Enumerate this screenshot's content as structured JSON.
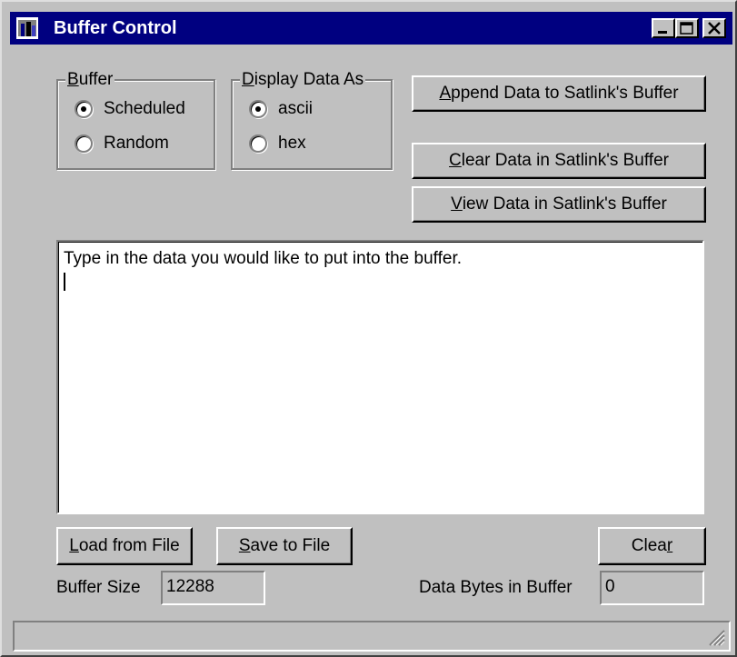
{
  "window": {
    "title": "Buffer Control",
    "icon": "app-icon"
  },
  "titlebar_buttons": {
    "minimize": "minimize-icon",
    "maximize": "maximize-icon",
    "close": "close-icon"
  },
  "buffer_group": {
    "legend_prefix": "",
    "legend_ul": "B",
    "legend_rest": "uffer",
    "options": [
      {
        "label": "Scheduled",
        "checked": true
      },
      {
        "label": "Random",
        "checked": false
      }
    ]
  },
  "display_group": {
    "legend_prefix": "",
    "legend_ul": "D",
    "legend_rest": "isplay Data As",
    "options": [
      {
        "label": "ascii",
        "checked": true
      },
      {
        "label": "hex",
        "checked": false
      }
    ]
  },
  "buttons": {
    "append": {
      "ul": "A",
      "rest": "ppend Data to Satlink's Buffer"
    },
    "clear_data": {
      "ul": "C",
      "rest": "lear Data in Satlink's Buffer"
    },
    "view_data": {
      "ul": "V",
      "rest": "iew Data in Satlink's Buffer"
    },
    "load": {
      "ul": "L",
      "rest": "oad from File"
    },
    "save": {
      "ul": "S",
      "rest": "ave to File"
    },
    "clear": {
      "pre": "Clea",
      "ul": "r"
    }
  },
  "editor": {
    "text": "Type in the data you would like to put into the buffer."
  },
  "buffer_size": {
    "label": "Buffer Size",
    "value": "12288"
  },
  "data_bytes": {
    "label": "Data Bytes in Buffer",
    "value": "0"
  },
  "colors": {
    "titlebar": "#000080",
    "face": "#c0c0c0"
  }
}
